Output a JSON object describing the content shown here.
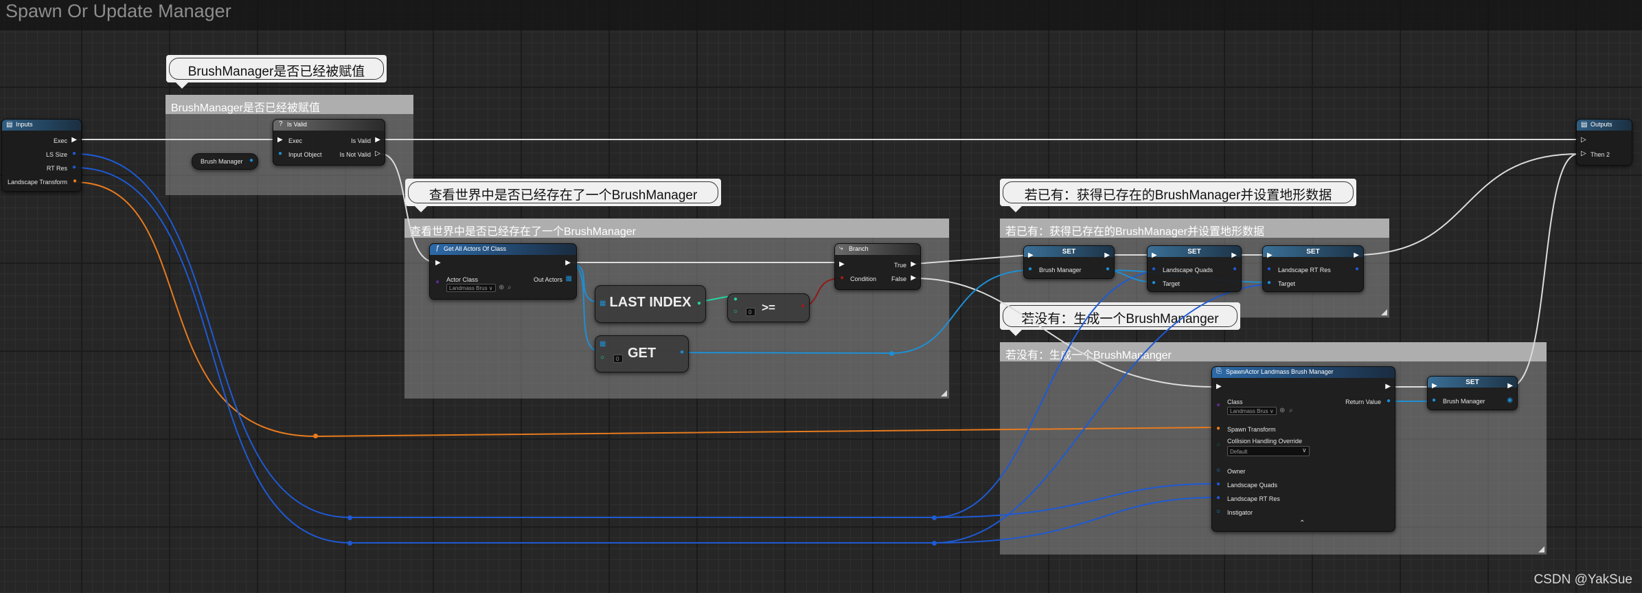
{
  "graph": {
    "title": "Spawn Or Update Manager"
  },
  "colors": {
    "exec": "#e0e0e0",
    "object": "#1e8fd4",
    "struct_transform": "#e87b1e",
    "array": "#1e5ad4",
    "bool": "#8f1a1a",
    "int": "#26d3a0"
  },
  "comments": {
    "is_valid": {
      "bubble": "BrushManager是否已经被赋值",
      "title": "BrushManager是否已经被赋值"
    },
    "check_world": {
      "bubble": "查看世界中是否已经存在了一个BrushManager",
      "title": "查看世界中是否已经存在了一个BrushManager"
    },
    "if_exists": {
      "bubble": "若已有：获得已存在的BrushManager并设置地形数据",
      "title": "若已有：获得已存在的BrushManager并设置地形数据"
    },
    "if_none": {
      "bubble": "若没有：生成一个BrushMananger",
      "title": "若没有：生成一个BrushMananger"
    }
  },
  "nodes": {
    "inputs": {
      "title": "Inputs",
      "icon": "function-entry-icon",
      "pins": [
        "Exec",
        "LS Size",
        "RT Res",
        "Landscape Transform"
      ]
    },
    "outputs": {
      "title": "Outputs",
      "icon": "function-return-icon",
      "pins": [
        "",
        "Then 2"
      ]
    },
    "brush_manager_get": {
      "label": "Brush Manager"
    },
    "is_valid": {
      "title": "Is Valid",
      "icon": "question-icon",
      "pins_in": [
        "Exec",
        "Input Object"
      ],
      "pins_out": [
        "Is Valid",
        "Is Not Valid"
      ]
    },
    "get_all_actors": {
      "title": "Get All Actors Of Class",
      "icon": "function-icon",
      "pins_in": [
        "Actor Class"
      ],
      "pins_out": [
        "Out Actors"
      ],
      "actor_class_value": "Landmass Brus ∨"
    },
    "last_index": {
      "label": "LAST INDEX"
    },
    "gte": {
      "label": ">=",
      "default_value": "0"
    },
    "get": {
      "label": "GET",
      "default_value": "0"
    },
    "branch": {
      "title": "Branch",
      "icon": "branch-icon",
      "pins_in": [
        "Condition"
      ],
      "pins_out": [
        "True",
        "False"
      ]
    },
    "set1": {
      "title": "SET",
      "pins": [
        "Brush Manager"
      ]
    },
    "set2": {
      "title": "SET",
      "pins": [
        "Landscape Quads",
        "Target"
      ]
    },
    "set3": {
      "title": "SET",
      "pins": [
        "Landscape RT Res",
        "Target"
      ]
    },
    "spawn_actor": {
      "title": "SpawnActor Landmass Brush Manager",
      "icon": "spawn-actor-icon",
      "pins_in": [
        "Class",
        "Spawn Transform",
        "Collision Handling Override",
        "Owner",
        "Landscape Quads",
        "Landscape RT Res",
        "Instigator"
      ],
      "pins_out": [
        "Return Value"
      ],
      "class_value": "Landmass Brus ∨",
      "collision_value": "Default",
      "collapse_arrow": "⌃"
    },
    "set4": {
      "title": "SET",
      "pins": [
        "Brush Manager"
      ]
    }
  },
  "watermark": "CSDN @YakSue"
}
